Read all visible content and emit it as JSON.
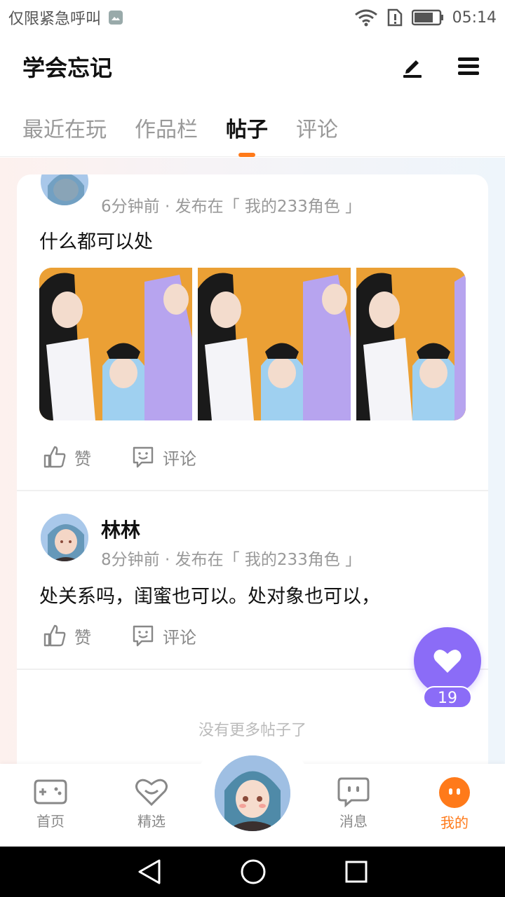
{
  "status_bar": {
    "carrier": "仅限紧急呼叫",
    "time": "05:14",
    "icons": [
      "image-icon",
      "wifi-icon",
      "sim-alert-icon",
      "battery-icon"
    ]
  },
  "header": {
    "title": "学会忘记",
    "edit_icon": "pen-icon",
    "menu_icon": "hamburger-menu-icon"
  },
  "tabs": [
    {
      "label": "最近在玩",
      "active": false
    },
    {
      "label": "作品栏",
      "active": false
    },
    {
      "label": "帖子",
      "active": true
    },
    {
      "label": "评论",
      "active": false
    }
  ],
  "posts": [
    {
      "time": "6分钟前 · 发布在「 我的233角色 」",
      "text": "什么都可以处",
      "image_count": 3,
      "like_label": "赞",
      "comment_label": "评论"
    },
    {
      "author": "林林",
      "time": "8分钟前 · 发布在「 我的233角色 」",
      "text": "处关系吗，闺蜜也可以。处对象也可以，",
      "like_label": "赞",
      "comment_label": "评论"
    }
  ],
  "no_more": "没有更多帖子了",
  "fab": {
    "count": "19",
    "icon": "heart-icon"
  },
  "bottom_nav": [
    {
      "label": "首页",
      "icon": "gamepad-icon",
      "active": false
    },
    {
      "label": "精选",
      "icon": "heart-chat-icon",
      "active": false
    },
    {
      "label": "消息",
      "icon": "chat-bubble-icon",
      "active": false
    },
    {
      "label": "我的",
      "icon": "profile-dots-icon",
      "active": true
    }
  ],
  "colors": {
    "accent": "#ff7a1a",
    "fab": "#8b6cf7",
    "image_bg": "#eba035"
  }
}
